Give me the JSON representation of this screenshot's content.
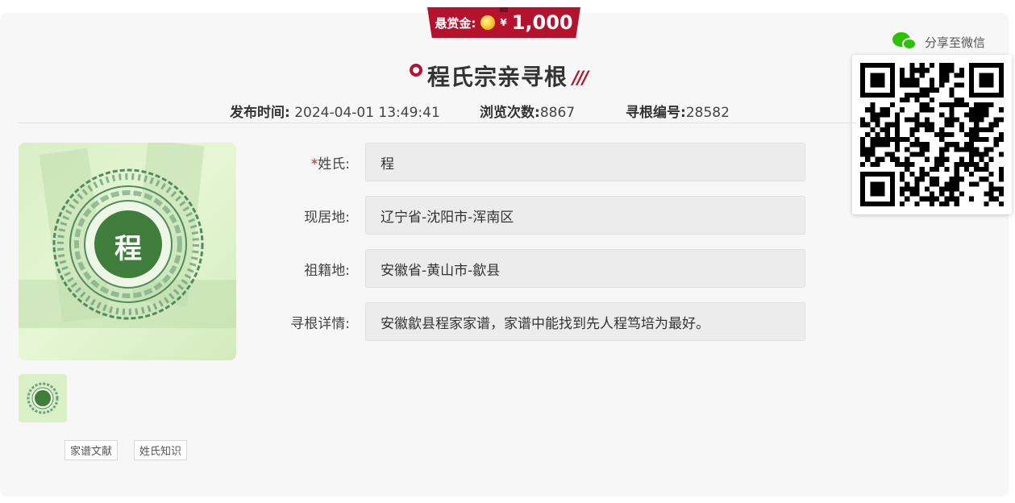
{
  "reward": {
    "label": "悬赏金:",
    "currency": "¥",
    "amount": "1,000"
  },
  "share": {
    "label": "分享至微信",
    "icon": "wechat-icon"
  },
  "title": "程氏宗亲寻根",
  "meta": {
    "publish_label": "发布时间:",
    "publish_value": "2024-04-01 13:49:41",
    "views_label": "浏览次数:",
    "views_value": "8867",
    "id_label": "寻根编号:",
    "id_value": "28582"
  },
  "image": {
    "character": "程"
  },
  "form": [
    {
      "label": "姓氏:",
      "required": true,
      "value": "程"
    },
    {
      "label": "现居地:",
      "required": false,
      "value": "辽宁省-沈阳市-浑南区"
    },
    {
      "label": "祖籍地:",
      "required": false,
      "value": "安徽省-黄山市-歙县"
    },
    {
      "label": "寻根详情:",
      "required": false,
      "value": "安徽歙县程家家谱，家谱中能找到先人程笃培为最好。"
    }
  ],
  "tags": [
    "家谱文献",
    "姓氏知识"
  ],
  "colors": {
    "accent": "#b5122e",
    "seal_green": "#3f7e3a",
    "wechat_green": "#2dc100"
  }
}
